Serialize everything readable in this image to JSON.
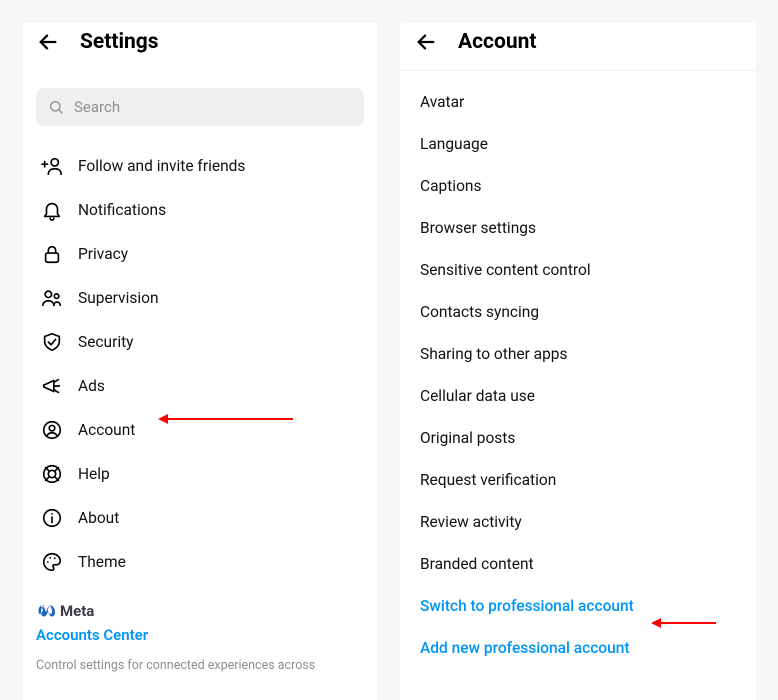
{
  "left": {
    "title": "Settings",
    "search_placeholder": "Search",
    "items": [
      {
        "label": "Follow and invite friends"
      },
      {
        "label": "Notifications"
      },
      {
        "label": "Privacy"
      },
      {
        "label": "Supervision"
      },
      {
        "label": "Security"
      },
      {
        "label": "Ads"
      },
      {
        "label": "Account"
      },
      {
        "label": "Help"
      },
      {
        "label": "About"
      },
      {
        "label": "Theme"
      }
    ],
    "meta_brand": "Meta",
    "accounts_center": "Accounts Center",
    "meta_desc": "Control settings for connected experiences across"
  },
  "right": {
    "title": "Account",
    "items": [
      {
        "label": "Avatar"
      },
      {
        "label": "Language"
      },
      {
        "label": "Captions"
      },
      {
        "label": "Browser settings"
      },
      {
        "label": "Sensitive content control"
      },
      {
        "label": "Contacts syncing"
      },
      {
        "label": "Sharing to other apps"
      },
      {
        "label": "Cellular data use"
      },
      {
        "label": "Original posts"
      },
      {
        "label": "Request verification"
      },
      {
        "label": "Review activity"
      },
      {
        "label": "Branded content"
      },
      {
        "label": "Switch to professional account",
        "link": true
      },
      {
        "label": "Add new professional account",
        "link": true
      }
    ]
  }
}
